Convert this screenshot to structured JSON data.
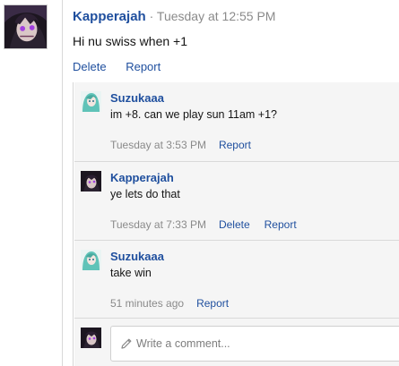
{
  "post": {
    "author": "Kapperajah",
    "separator": " · ",
    "timestamp": "Tuesday at 12:55 PM",
    "body": "Hi nu swiss when +1",
    "actions": {
      "delete": "Delete",
      "report": "Report"
    }
  },
  "replies": [
    {
      "author": "Suzukaaa",
      "text": "im +8. can we play sun 11am +1?",
      "time": "Tuesday at 3:53 PM",
      "actions": [
        "Report"
      ]
    },
    {
      "author": "Kapperajah",
      "text": "ye lets do that",
      "time": "Tuesday at 7:33 PM",
      "actions": [
        "Delete",
        "Report"
      ]
    },
    {
      "author": "Suzukaaa",
      "text": "take win",
      "time": "51 minutes ago",
      "actions": [
        "Report"
      ]
    }
  ],
  "composer": {
    "placeholder": "Write a comment..."
  },
  "icons": {
    "composer": "pencil-icon"
  },
  "colors": {
    "link": "#1f4f9e",
    "meta": "#8a8a8a",
    "reply_bg": "#f5f5f5"
  }
}
